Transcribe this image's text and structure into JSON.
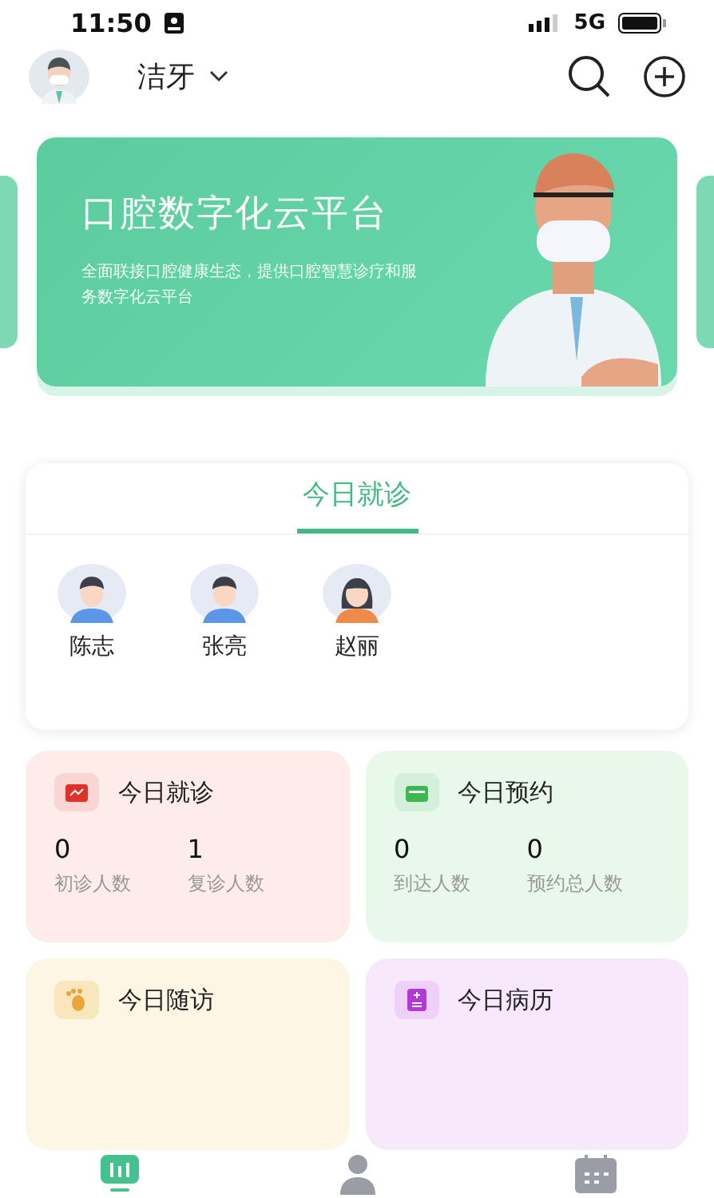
{
  "status_bar": {
    "time": "11:50",
    "network": "5G"
  },
  "header": {
    "clinic": "洁牙"
  },
  "banner": {
    "title": "口腔数字化云平台",
    "subtitle": "全面联接口腔健康生态，提供口腔智慧诊疗和服务数字化云平台"
  },
  "today_panel": {
    "tabs": [
      {
        "label": "今日就诊",
        "selected": true
      }
    ],
    "patients": [
      {
        "name": "陈志",
        "kind": "male"
      },
      {
        "name": "张亮",
        "kind": "male"
      },
      {
        "name": "赵丽",
        "kind": "female"
      }
    ]
  },
  "stats": [
    {
      "title": "今日就诊",
      "kind": "visit",
      "color": "#fdecea",
      "metrics": [
        {
          "value": "0",
          "label": "初诊人数"
        },
        {
          "value": "1",
          "label": "复诊人数"
        }
      ]
    },
    {
      "title": "今日预约",
      "kind": "appointment",
      "color": "#e8f8ea",
      "metrics": [
        {
          "value": "0",
          "label": "到达人数"
        },
        {
          "value": "0",
          "label": "预约总人数"
        }
      ]
    },
    {
      "title": "今日随访",
      "kind": "followup",
      "color": "#fdf6e4"
    },
    {
      "title": "今日病历",
      "kind": "record",
      "color": "#f7e8fc"
    }
  ],
  "tab_bar": [
    {
      "kind": "stats",
      "selected": true
    },
    {
      "kind": "doctor",
      "selected": false
    },
    {
      "kind": "calendar",
      "selected": false
    }
  ]
}
